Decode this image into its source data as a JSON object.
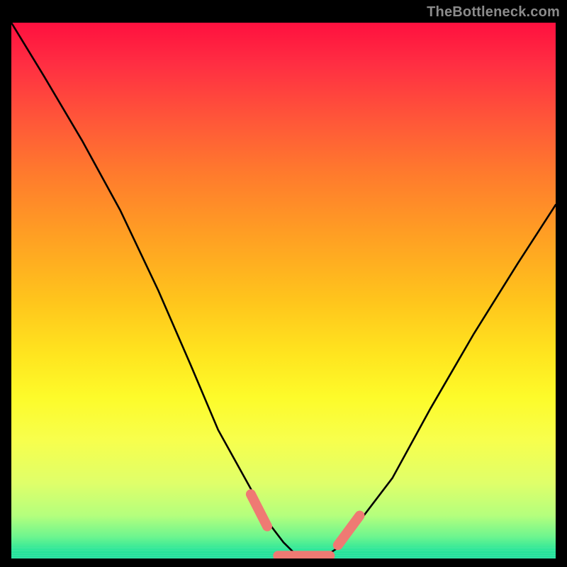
{
  "watermark": "TheBottleneck.com",
  "chart_data": {
    "type": "line",
    "title": "",
    "xlabel": "",
    "ylabel": "",
    "xlim": [
      0,
      100
    ],
    "ylim": [
      0,
      100
    ],
    "grid": false,
    "series": [
      {
        "name": "bottleneck-curve",
        "x": [
          0,
          6,
          13,
          20,
          27,
          33,
          38,
          44,
          47,
          50,
          53,
          57,
          60,
          64,
          70,
          77,
          85,
          93,
          100
        ],
        "y": [
          100,
          90,
          78,
          65,
          50,
          36,
          24,
          13,
          7,
          3,
          0,
          0,
          2,
          7,
          15,
          28,
          42,
          55,
          66
        ]
      }
    ],
    "markers": [
      {
        "name": "left-marker",
        "x": [
          44,
          47
        ],
        "y": [
          12,
          6
        ]
      },
      {
        "name": "bottom-marker",
        "x": [
          49,
          58.5
        ],
        "y": [
          0.5,
          0.5
        ]
      },
      {
        "name": "right-marker",
        "x": [
          60,
          64
        ],
        "y": [
          2.5,
          8
        ]
      }
    ],
    "colors": {
      "curve": "#000000",
      "marker": "#ef7a73",
      "gradient_top": "#ff103f",
      "gradient_bottom": "#1adf9b"
    }
  }
}
